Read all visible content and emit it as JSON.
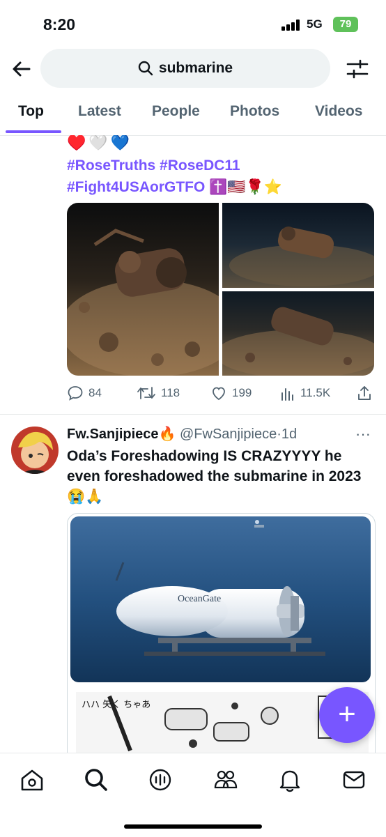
{
  "status": {
    "time": "8:20",
    "network": "5G",
    "battery": "79"
  },
  "search": {
    "query": "submarine"
  },
  "tabs": [
    {
      "label": "Top",
      "active": true
    },
    {
      "label": "Latest"
    },
    {
      "label": "People"
    },
    {
      "label": "Photos"
    },
    {
      "label": "Videos"
    }
  ],
  "tweet1": {
    "emoji_line": "♥️🤍💙",
    "hashtag_line1": "#RoseTruths #RoseDC11",
    "hashtag_line2": "#Fight4USAorGTFO ✝️🇺🇸🌹⭐",
    "stats": {
      "replies": "84",
      "retweets": "118",
      "likes": "199",
      "views": "11.5K"
    }
  },
  "tweet2": {
    "display_name": "Fw.Sanjipiece🔥",
    "handle": "@FwSanjipiece",
    "separator": "·",
    "time": "1d",
    "more": "···",
    "text": "Oda’s Foreshadowing IS CRAZYYYY he even foreshadowed the submarine in 2023 😭🙏",
    "image_text": "OceanGate",
    "manga_text": "ハハ 矢く ちゃあ"
  },
  "fab": {
    "label": "+"
  },
  "colors": {
    "accent": "#7856ff",
    "text": "#0f1419",
    "secondary": "#536471",
    "border": "#e6e9ea"
  },
  "icons": [
    "back-arrow-icon",
    "search-icon",
    "filter-icon",
    "reply-icon",
    "retweet-icon",
    "like-icon",
    "views-icon",
    "share-icon",
    "home-icon",
    "explore-icon",
    "grok-icon",
    "communities-icon",
    "notifications-icon",
    "messages-icon"
  ]
}
